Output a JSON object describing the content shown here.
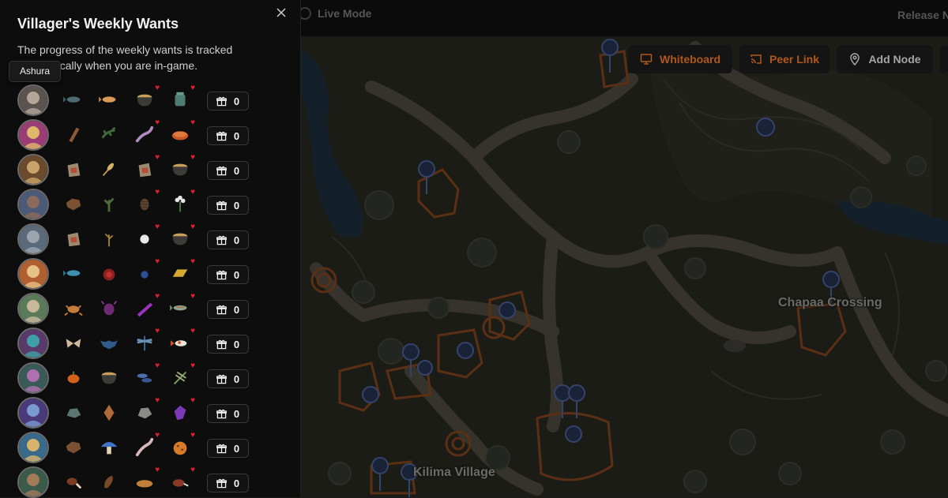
{
  "topbar": {
    "live_mode": "Live Mode",
    "release_notes": "Release N"
  },
  "map": {
    "labels": {
      "chapaa_crossing": "Chapaa Crossing",
      "kilima_village": "Kilima Village"
    },
    "tools": {
      "whiteboard": "Whiteboard",
      "peer_link": "Peer Link",
      "add_node": "Add Node"
    }
  },
  "panel": {
    "title": "Villager's Weekly Wants",
    "description": "The progress of the weekly wants is tracked automatically when you are in-game.",
    "tooltip": "Ashura",
    "villagers": [
      {
        "gift_count": "0",
        "wants": [
          "fish-icon",
          "fish-orange-icon",
          "stew-pot-icon",
          "tea-jar-icon"
        ],
        "hearts": [
          false,
          false,
          true,
          true
        ]
      },
      {
        "gift_count": "0",
        "wants": [
          "plank-icon",
          "lizard-icon",
          "worm-icon",
          "pie-icon"
        ],
        "hearts": [
          false,
          false,
          true,
          true
        ]
      },
      {
        "gift_count": "0",
        "wants": [
          "flour-sack-icon",
          "wheat-icon",
          "flour-sack-icon",
          "stew-pot-icon"
        ],
        "hearts": [
          false,
          false,
          true,
          true
        ]
      },
      {
        "gift_count": "0",
        "wants": [
          "bark-icon",
          "herb-icon",
          "pinecone-icon",
          "flower-bundle-icon"
        ],
        "hearts": [
          false,
          false,
          true,
          true
        ]
      },
      {
        "gift_count": "0",
        "wants": [
          "flour-sack-icon",
          "sapling-icon",
          "pearl-icon",
          "stew-pot-icon"
        ],
        "hearts": [
          false,
          false,
          true,
          true
        ]
      },
      {
        "gift_count": "0",
        "wants": [
          "fish-blue-icon",
          "berry-icon",
          "blueberry-icon",
          "gold-bar-icon"
        ],
        "hearts": [
          false,
          false,
          true,
          true
        ]
      },
      {
        "gift_count": "0",
        "wants": [
          "crab-icon",
          "beetle-icon",
          "purple-bar-icon",
          "fish-green-icon"
        ],
        "hearts": [
          false,
          false,
          true,
          true
        ]
      },
      {
        "gift_count": "0",
        "wants": [
          "moth-icon",
          "bat-icon",
          "dragonfly-icon",
          "koi-icon"
        ],
        "hearts": [
          false,
          false,
          true,
          true
        ]
      },
      {
        "gift_count": "0",
        "wants": [
          "pumpkin-icon",
          "stew-pot-icon",
          "fish-cluster-icon",
          "dragonfly-green-icon"
        ],
        "hearts": [
          false,
          false,
          true,
          true
        ]
      },
      {
        "gift_count": "0",
        "wants": [
          "stone-icon",
          "arrowhead-icon",
          "ore-icon",
          "crystal-icon"
        ],
        "hearts": [
          false,
          false,
          true,
          true
        ]
      },
      {
        "gift_count": "0",
        "wants": [
          "bark-icon",
          "mushroom-icon",
          "eel-icon",
          "cookie-icon"
        ],
        "hearts": [
          false,
          false,
          true,
          true
        ]
      },
      {
        "gift_count": "0",
        "wants": [
          "drumstick-icon",
          "bean-icon",
          "bread-icon",
          "meat-icon"
        ],
        "hearts": [
          false,
          false,
          true,
          true
        ]
      }
    ]
  },
  "colors": {
    "accent_orange": "#b0581b",
    "heart_red": "#e0202a",
    "panel_bg": "#0d0d0d",
    "map_bg": "#1b1a16"
  }
}
